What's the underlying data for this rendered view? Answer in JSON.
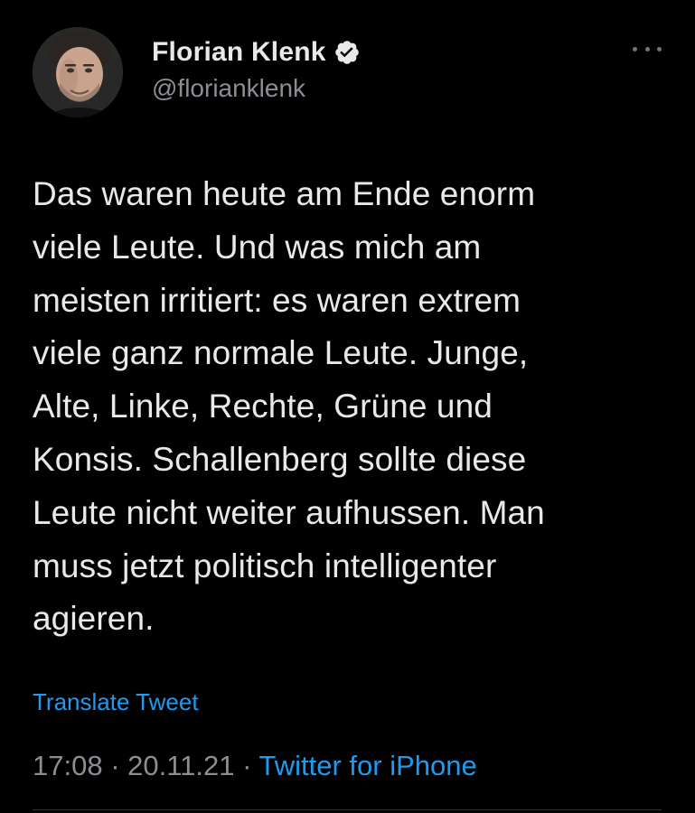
{
  "tweet": {
    "author": {
      "display_name": "Florian Klenk",
      "handle": "@florianklenk",
      "verified_icon": "verified-badge-icon",
      "avatar": "avatar-photo"
    },
    "more_icon": "more-options-icon",
    "text": "Das waren heute am Ende enorm\nviele Leute. Und was mich am\nmeisten irritiert: es waren extrem\nviele ganz normale Leute. Junge,\nAlte, Linke, Rechte, Grüne und\nKonsis. Schallenberg sollte diese\nLeute nicht weiter aufhussen. Man\nmuss jetzt politisch intelligenter\nagieren.",
    "translate_label": "Translate Tweet",
    "time": "17:08",
    "separator": " · ",
    "date": "20.11.21",
    "source": "Twitter for iPhone"
  },
  "colors": {
    "background": "#000000",
    "text": "#e7e9ea",
    "secondary": "#8b8f94",
    "accent": "#1d9bf0"
  }
}
